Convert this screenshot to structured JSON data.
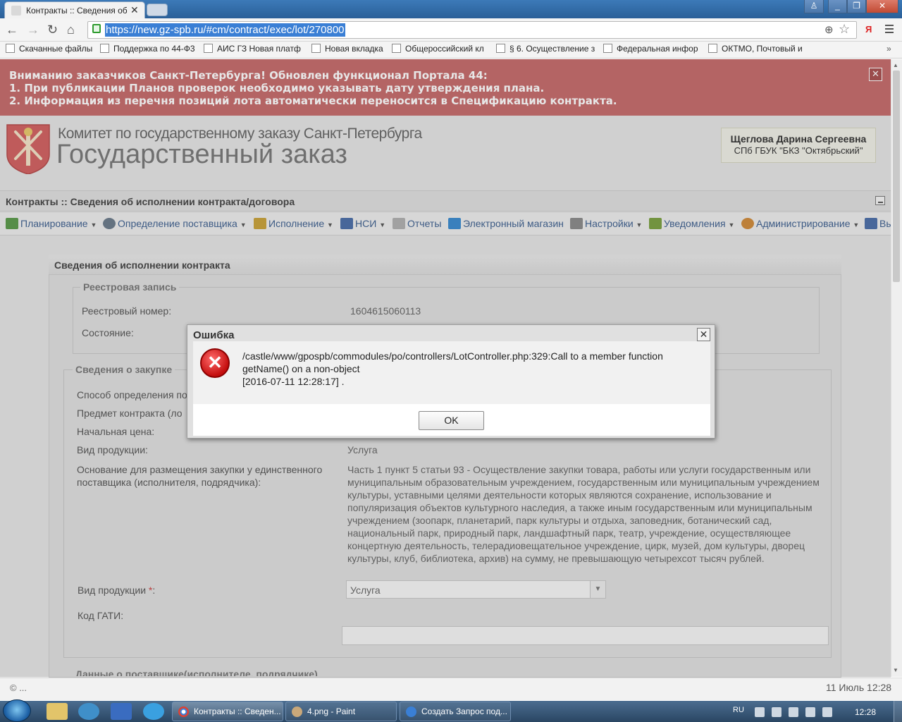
{
  "browser": {
    "tab_title": "Контракты :: Сведения об",
    "url": "https://new.gz-spb.ru/#cm/contract/exec/lot/270800",
    "yandex_label": "Я",
    "bookmarks": [
      {
        "label": "Скачанные файлы",
        "icon": "download-icon"
      },
      {
        "label": "Поддержка по 44-Ф3",
        "icon": "bookmark-icon"
      },
      {
        "label": "АИС ГЗ Новая платф",
        "icon": "bookmark-icon"
      },
      {
        "label": "Новая вкладка",
        "icon": "page-icon"
      },
      {
        "label": "Общероссийский кл",
        "icon": "bookmark-icon"
      },
      {
        "label": "§ 6. Осуществление з",
        "icon": "bookmark-icon"
      },
      {
        "label": "Федеральная инфор",
        "icon": "page-icon"
      },
      {
        "label": "ОКТМО, Почтовый и",
        "icon": "bookmark-icon"
      }
    ]
  },
  "alert": {
    "line1": "Вниманию заказчиков Санкт-Петербурга! Обновлен функционал Портала 44:",
    "line2": "1. При публикации Планов проверок необходимо указывать дату утверждения плана.",
    "line3": "2. Информация из перечня позиций лота автоматически переносится в Спецификацию контракта.",
    "close": "✕"
  },
  "header": {
    "committee": "Комитет по государственному заказу Санкт-Петербурга",
    "title": "Государственный заказ",
    "user_name": "Щеглова Дарина Сергеевна",
    "user_org": "СПб ГБУК \"БКЗ \"Октябрьский\""
  },
  "breadcrumb": "Контракты :: Сведения об исполнении контракта/договора",
  "menu": [
    {
      "label": "Планирование",
      "dropdown": true,
      "icon": "planning-icon",
      "color": "#5a9a4a"
    },
    {
      "label": "Определение поставщика",
      "dropdown": true,
      "icon": "gear-icon",
      "color": "#6a7a8a"
    },
    {
      "label": "Исполнение",
      "dropdown": true,
      "icon": "execution-icon",
      "color": "#c9a23a"
    },
    {
      "label": "НСИ",
      "dropdown": true,
      "icon": "book-icon",
      "color": "#4a6ea8"
    },
    {
      "label": "Отчеты",
      "dropdown": false,
      "icon": "report-icon",
      "color": "#b0b0b0"
    },
    {
      "label": "Электронный магазин",
      "dropdown": false,
      "icon": "cart-icon",
      "color": "#3a8ad0"
    },
    {
      "label": "Настройки",
      "dropdown": true,
      "icon": "wrench-icon",
      "color": "#8a8a8a"
    },
    {
      "label": "Уведомления",
      "dropdown": true,
      "icon": "notification-icon",
      "color": "#7aa040"
    },
    {
      "label": "Администрирование",
      "dropdown": true,
      "icon": "user-icon",
      "color": "#d08a3a"
    },
    {
      "label": "Вы",
      "dropdown": false,
      "icon": "exit-icon",
      "color": "#4a6ea8"
    }
  ],
  "panel": {
    "title": "Сведения об исполнении контракта",
    "registry": {
      "legend": "Реестровая запись",
      "number_label": "Реестровый номер:",
      "number_value": "1604615060113",
      "state_label": "Состояние:"
    },
    "purchase": {
      "legend": "Сведения о закупке",
      "method_label": "Способ определения по",
      "subject_label": "Предмет контракта (ло",
      "price_label": "Начальная цена:",
      "product_label": "Вид продукции:",
      "product_value": "Услуга",
      "basis_label": "Основание для размещения закупки у единственного поставщика (исполнителя, подрядчика):",
      "basis_value": "Часть 1 пункт 5 статьи 93 - Осуществление закупки товара, работы или услуги государственным или муниципальным образовательным учреждением, государственным или муниципальным учреждением культуры, уставными целями деятельности которых являются сохранение, использование и популяризация объектов культурного наследия, а также иным государственным или муниципальным учреждением (зоопарк, планетарий, парк культуры и отдыха, заповедник, ботанический сад, национальный парк, природный парк, ландшафтный парк, театр, учреждение, осуществляющее концертную деятельность, телерадиовещательное учреждение, цирк, музей, дом культуры, дворец культуры, клуб, библиотека, архив) на сумму, не превышающую четырехсот тысяч рублей.",
      "product_select_label": "Вид продукции",
      "required_mark": "*",
      "colon": ":",
      "product_select_value": "Услуга",
      "gati_label": "Код ГАТИ:",
      "gati_value": ""
    },
    "supplier_legend": "Данные о поставщике(исполнителе, подрядчике)"
  },
  "footer": {
    "copyright": "© ...",
    "datetime": "11 Июль 12:28"
  },
  "dialog": {
    "title": "Ошибка",
    "message_line1": "/castle/www/gpospb/commodules/po/controllers/LotController.php:329:Call to a member function",
    "message_line2": "getName() on a non-object",
    "message_line3": "[2016-07-11 12:28:17] .",
    "ok": "OK",
    "close": "✕",
    "icon": "error-icon"
  },
  "taskbar": {
    "windows": [
      {
        "label": "Контракты :: Сведен...",
        "icon": "chrome-icon"
      },
      {
        "label": "4.png - Paint",
        "icon": "paint-icon"
      },
      {
        "label": "Создать Запрос под...",
        "icon": "help-icon"
      }
    ],
    "lang": "RU",
    "clock": "12:28"
  }
}
